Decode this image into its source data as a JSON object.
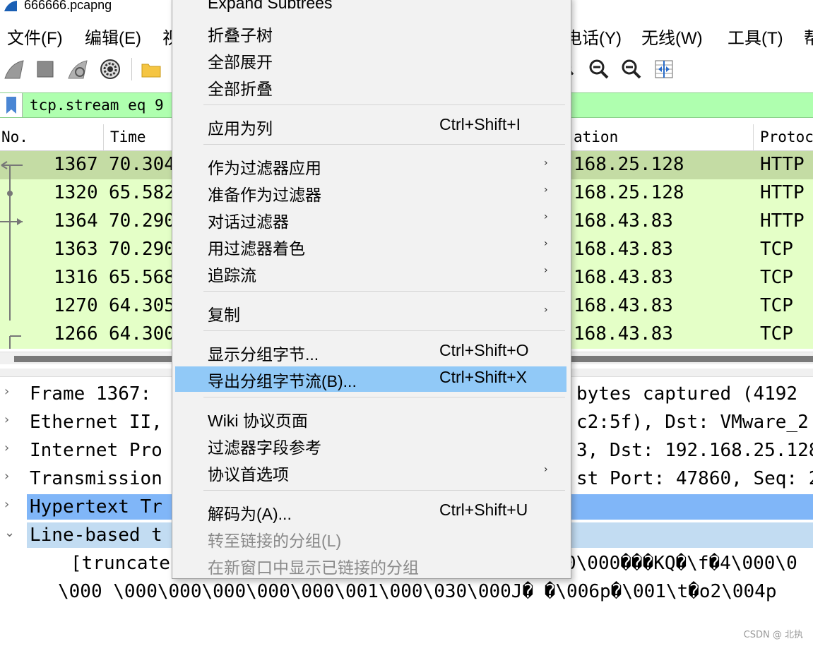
{
  "window": {
    "title": "666666.pcapng"
  },
  "menubar": {
    "items": [
      "文件(F)",
      "编辑(E)",
      "视",
      "电话(Y)",
      "无线(W)",
      "工具(T)",
      "帮"
    ]
  },
  "toolbar": {
    "icons": [
      "shark-fin-start-icon",
      "stop-square-icon",
      "restart-fin-icon",
      "gear-icon",
      "folder-icon",
      "search-icon",
      "zoom-in-icon",
      "zoom-out-icon",
      "resize-columns-icon"
    ]
  },
  "filter": {
    "value": "tcp.stream eq 9"
  },
  "packet_list": {
    "columns": {
      "no": "No.",
      "time": "Time",
      "destination": "ation",
      "protocol": "Protoco"
    },
    "rows": [
      {
        "no": "1367",
        "time": "70.304",
        "dst": "168.25.128",
        "proto": "HTTP"
      },
      {
        "no": "1320",
        "time": "65.582",
        "dst": "168.25.128",
        "proto": "HTTP"
      },
      {
        "no": "1364",
        "time": "70.290",
        "dst": "168.43.83",
        "proto": "HTTP"
      },
      {
        "no": "1363",
        "time": "70.290",
        "dst": "168.43.83",
        "proto": "TCP"
      },
      {
        "no": "1316",
        "time": "65.568",
        "dst": "168.43.83",
        "proto": "TCP"
      },
      {
        "no": "1270",
        "time": "64.305",
        "dst": "168.43.83",
        "proto": "TCP"
      },
      {
        "no": "1266",
        "time": "64.300",
        "dst": "168.43.83",
        "proto": "TCP"
      }
    ]
  },
  "details": {
    "rows": [
      {
        "left": "Frame 1367:",
        "right": "bytes captured (4192"
      },
      {
        "left": "Ethernet II,",
        "right": "c2:5f), Dst: VMware_2"
      },
      {
        "left": "Internet Pro",
        "right": "3, Dst: 192.168.25.128"
      },
      {
        "left": "Transmission",
        "right": "st Port: 47860, Seq: 2"
      },
      {
        "left": "Hypertext Tr",
        "right": ""
      },
      {
        "left": "Line-based t",
        "right": ""
      }
    ],
    "line1_left": "[truncate",
    "line1_right": "0\\000���KQ�\\f�4\\000\\0",
    "line2": "\\000 \\000\\000\\000\\000\\000\\001\\000\\030\\000J� �\\006p�\\001\\t�o2\\004p"
  },
  "context_menu": {
    "items": [
      {
        "label": "Expand Subtrees"
      },
      {
        "label": "折叠子树"
      },
      {
        "label": "全部展开"
      },
      {
        "label": "全部折叠"
      },
      {
        "label": "应用为列",
        "shortcut": "Ctrl+Shift+I"
      },
      {
        "label": "作为过滤器应用",
        "submenu": "›"
      },
      {
        "label": "准备作为过滤器",
        "submenu": "›"
      },
      {
        "label": "对话过滤器",
        "submenu": "›"
      },
      {
        "label": "用过滤器着色",
        "submenu": "›"
      },
      {
        "label": "追踪流",
        "submenu": "›"
      },
      {
        "label": "复制",
        "submenu": "›"
      },
      {
        "label": "显示分组字节...",
        "shortcut": "Ctrl+Shift+O"
      },
      {
        "label": "导出分组字节流(B)...",
        "shortcut": "Ctrl+Shift+X"
      },
      {
        "label": "Wiki 协议页面"
      },
      {
        "label": "过滤器字段参考"
      },
      {
        "label": "协议首选项",
        "submenu": "›"
      },
      {
        "label": "解码为(A)...",
        "shortcut": "Ctrl+Shift+U"
      },
      {
        "label": "转至链接的分组(L)"
      },
      {
        "label": "在新窗口中显示已链接的分组"
      }
    ]
  },
  "colors": {
    "filter_bg": "#afffaf",
    "row_bg": "#e4ffc7",
    "row_selected": "#c4dca4",
    "menu_highlight": "#91c9f7",
    "detail_selected": "#80b6f8",
    "detail_light": "#c2dcf2"
  },
  "watermark": "CSDN @    北执"
}
